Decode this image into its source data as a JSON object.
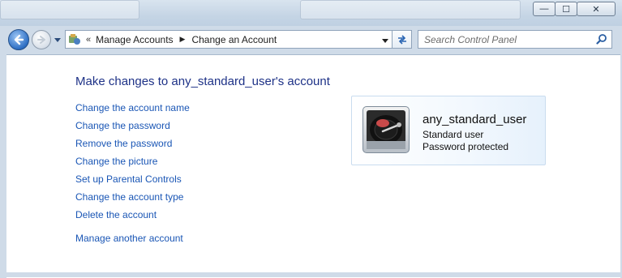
{
  "window": {
    "controls": {
      "minimize": "—",
      "maximize": "☐",
      "close": "✕"
    }
  },
  "nav": {
    "breadcrumb_prefix": "«",
    "breadcrumbs": [
      "Manage Accounts",
      "Change an Account"
    ],
    "search_placeholder": "Search Control Panel",
    "icons": {
      "back": "back-arrow-icon",
      "forward": "forward-arrow-icon",
      "history": "chevron-down-icon",
      "location": "control-panel-icon",
      "address_dropdown": "chevron-down-icon",
      "refresh": "refresh-icon",
      "search": "search-icon"
    }
  },
  "main": {
    "title": "Make changes to any_standard_user's account",
    "tasks": [
      "Change the account name",
      "Change the password",
      "Remove the password",
      "Change the picture",
      "Set up Parental Controls",
      "Change the account type",
      "Delete the account"
    ],
    "other_task": "Manage another account"
  },
  "account": {
    "name": "any_standard_user",
    "type": "Standard user",
    "password_status": "Password protected",
    "avatar_icon": "turntable-picture-icon"
  },
  "colors": {
    "link": "#1a56b5",
    "title": "#1e3287",
    "frame": "#cfdbe8",
    "card_border": "#c9dcef",
    "back_button": "#2e6fc4"
  }
}
